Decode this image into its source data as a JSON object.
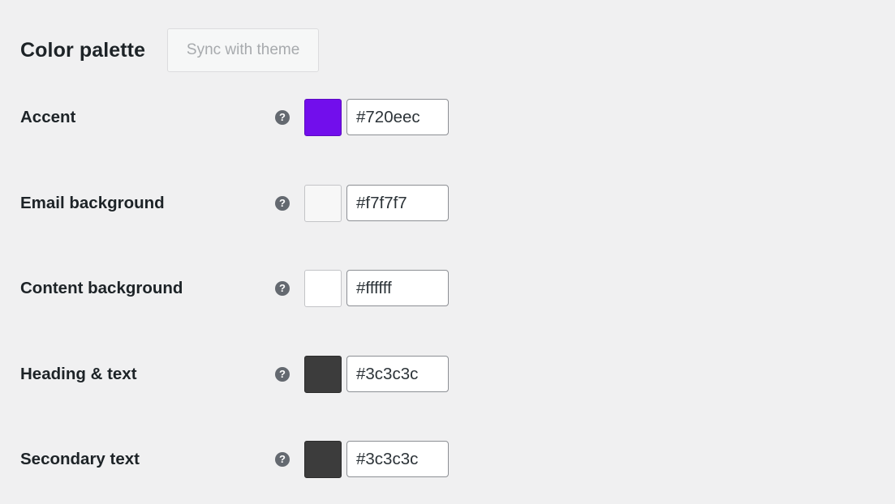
{
  "section": {
    "title": "Color palette",
    "sync_button_label": "Sync with theme"
  },
  "help_icon_glyph": "?",
  "colors": [
    {
      "label": "Accent",
      "value": "#720eec",
      "swatch": "#720eec",
      "swatch_border": "#5c0bc0"
    },
    {
      "label": "Email background",
      "value": "#f7f7f7",
      "swatch": "#f7f7f7",
      "swatch_border": "#c3c4c7"
    },
    {
      "label": "Content background",
      "value": "#ffffff",
      "swatch": "#ffffff",
      "swatch_border": "#c3c4c7"
    },
    {
      "label": "Heading & text",
      "value": "#3c3c3c",
      "swatch": "#3c3c3c",
      "swatch_border": "#2c2c2c"
    },
    {
      "label": "Secondary text",
      "value": "#3c3c3c",
      "swatch": "#3c3c3c",
      "swatch_border": "#2c2c2c"
    }
  ]
}
